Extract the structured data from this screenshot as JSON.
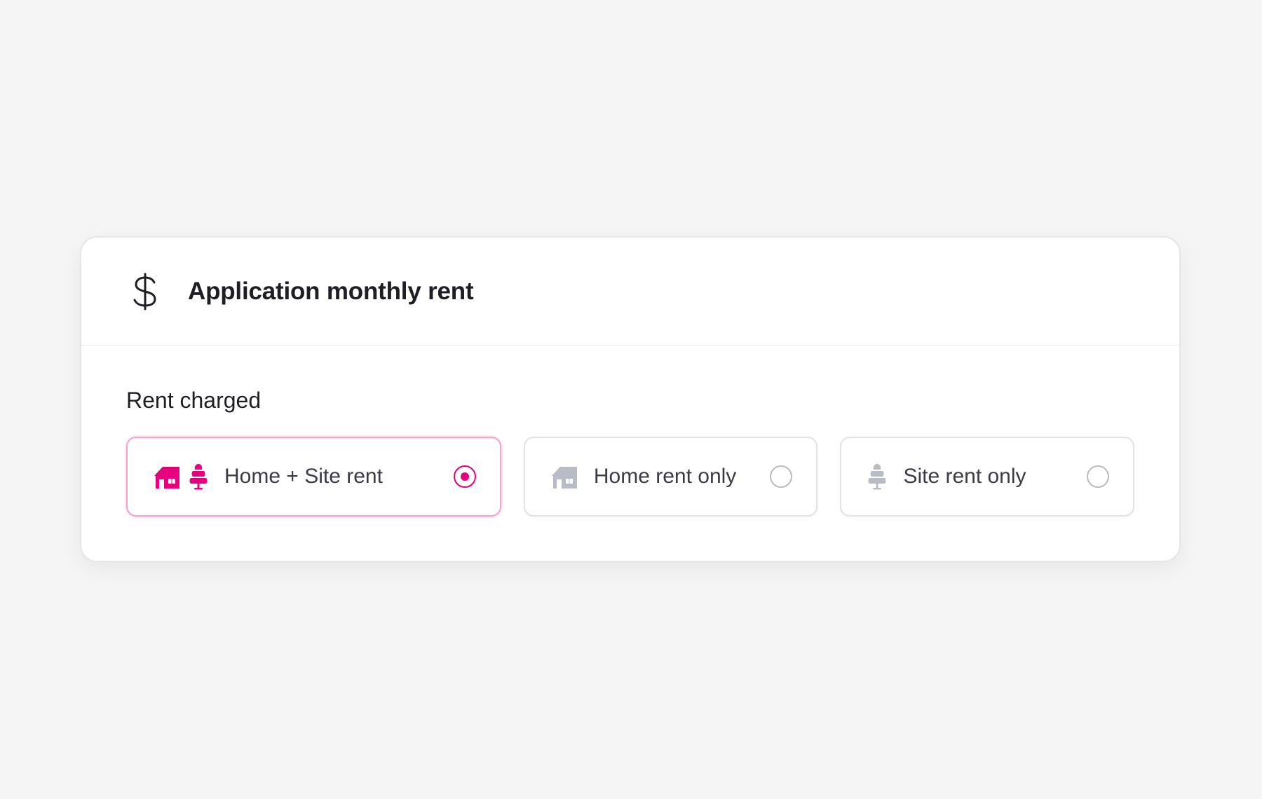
{
  "card": {
    "title": "Application monthly rent",
    "icon": "dollar-icon"
  },
  "section": {
    "label": "Rent charged"
  },
  "options": [
    {
      "label": "Home + Site rent",
      "icons": [
        "house-icon",
        "tree-icon"
      ],
      "selected": true
    },
    {
      "label": "Home rent only",
      "icons": [
        "house-icon"
      ],
      "selected": false
    },
    {
      "label": "Site rent only",
      "icons": [
        "tree-icon"
      ],
      "selected": false
    }
  ],
  "colors": {
    "accent": "#e6007e",
    "accent_border": "#f6a3cc",
    "inactive_icon": "#b9bcc6",
    "text": "#3b3b46",
    "title": "#1e1e24",
    "background": "#f5f5f5"
  }
}
